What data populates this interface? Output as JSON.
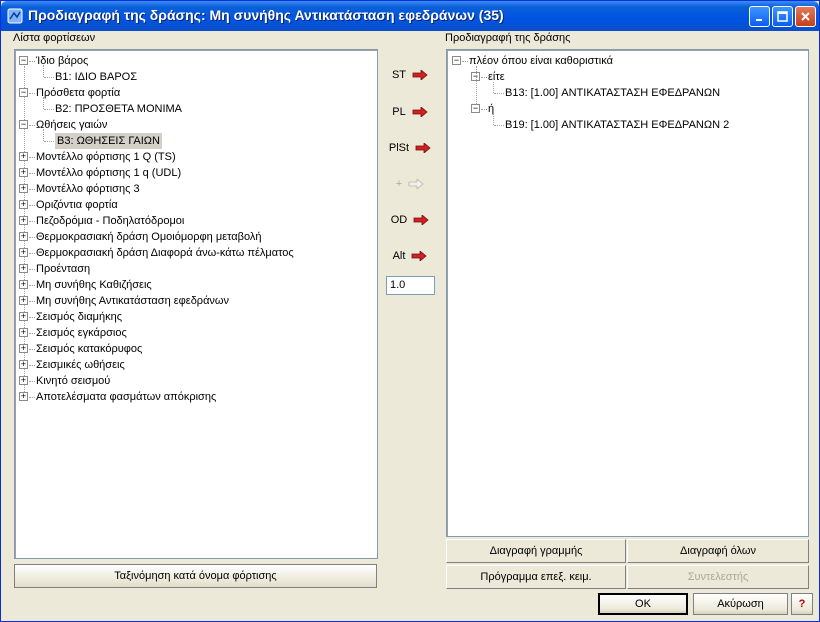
{
  "window": {
    "title": "Προδιαγραφή της δράσης: Μη συνήθης Αντικατάσταση εφεδράνων  (35)"
  },
  "left_panel": {
    "label": "Λίστα φορτίσεων",
    "tree": [
      {
        "label": "Ίδιο βάρος",
        "expanded": true,
        "children": [
          "B1: ΙΔΙΟ ΒΑΡΟΣ"
        ]
      },
      {
        "label": "Πρόσθετα φορτία",
        "expanded": true,
        "children": [
          "B2: ΠΡΟΣΘΕΤΑ ΜΟΝΙΜΑ"
        ]
      },
      {
        "label": "Ωθήσεις γαιών",
        "expanded": true,
        "children": [
          "B3: ΩΘΗΣΕΙΣ ΓΑΙΩΝ"
        ]
      },
      {
        "label": "Μοντέλλο φόρτισης 1 Q (TS)",
        "expanded": false
      },
      {
        "label": "Μοντέλλο φόρτισης 1 q (UDL)",
        "expanded": false
      },
      {
        "label": "Μοντέλλο φόρτισης 3",
        "expanded": false
      },
      {
        "label": "Οριζόντια φορτία",
        "expanded": false
      },
      {
        "label": "Πεζοδρόμια - Ποδηλατόδρομοι",
        "expanded": false
      },
      {
        "label": "Θερμοκρασιακή δράση Ομοιόμορφη μεταβολή",
        "expanded": false
      },
      {
        "label": "Θερμοκρασιακή δράση Διαφορά άνω-κάτω πέλματος",
        "expanded": false
      },
      {
        "label": "Προένταση",
        "expanded": false
      },
      {
        "label": "Μη συνήθης Καθιζήσεις",
        "expanded": false
      },
      {
        "label": "Μη συνήθης Αντικατάσταση εφεδράνων",
        "expanded": false
      },
      {
        "label": "Σεισμός διαμήκης",
        "expanded": false
      },
      {
        "label": "Σεισμός εγκάρσιος",
        "expanded": false
      },
      {
        "label": "Σεισμός κατακόρυφος",
        "expanded": false
      },
      {
        "label": "Σεισμικές ωθήσεις",
        "expanded": false
      },
      {
        "label": "Κινητό σεισμού",
        "expanded": false
      },
      {
        "label": "Αποτελέσματα φασμάτων απόκρισης",
        "expanded": false
      }
    ],
    "sort_button": "Ταξινόμηση κατά όνομα φόρτισης"
  },
  "middle": {
    "buttons": [
      {
        "label": "ST",
        "enabled": true
      },
      {
        "label": "PL",
        "enabled": true
      },
      {
        "label": "PlSt",
        "enabled": true
      },
      {
        "label": "+",
        "enabled": false
      },
      {
        "label": "OD",
        "enabled": true
      },
      {
        "label": "Alt",
        "enabled": true
      }
    ],
    "factor_value": "1.0"
  },
  "right_panel": {
    "label": "Προδιαγραφή της δράσης",
    "root": "πλέον όπου είναι καθοριστικά",
    "groups": [
      {
        "label": "είτε",
        "items": [
          "B13:  [1.00]  ΑΝΤΙΚΑΤΑΣΤΑΣΗ ΕΦΕΔΡΑΝΩΝ"
        ]
      },
      {
        "label": "ή",
        "items": [
          "B19:  [1.00]  ΑΝΤΙΚΑΤΑΣΤΑΣΗ ΕΦΕΔΡΑΝΩΝ 2"
        ]
      }
    ],
    "delete_line": "Διαγραφή γραμμής",
    "delete_all": "Διαγραφή όλων",
    "editor": "Πρόγραμμα επεξ. κειμ.",
    "coefficient": "Συντελεστής"
  },
  "footer": {
    "ok": "OK",
    "cancel": "Ακύρωση",
    "help": "?"
  },
  "colors": {
    "arrow": "#d42020",
    "titlebar": "#0054e3",
    "help": "#c00000"
  }
}
